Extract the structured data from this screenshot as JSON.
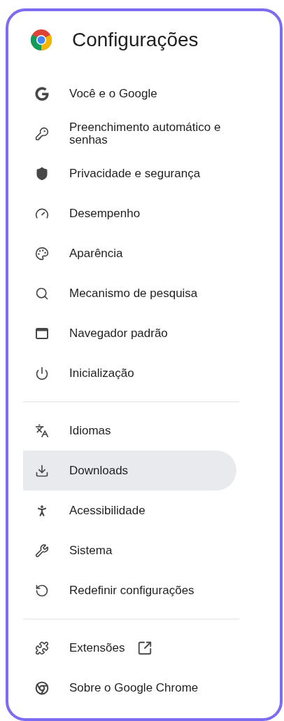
{
  "header": {
    "title": "Configurações"
  },
  "sections": [
    {
      "items": [
        {
          "label": "Você e o Google",
          "selected": false,
          "external_link": false
        },
        {
          "label": "Preenchimento automático e senhas",
          "selected": false,
          "external_link": false
        },
        {
          "label": "Privacidade e segurança",
          "selected": false,
          "external_link": false
        },
        {
          "label": "Desempenho",
          "selected": false,
          "external_link": false
        },
        {
          "label": "Aparência",
          "selected": false,
          "external_link": false
        },
        {
          "label": "Mecanismo de pesquisa",
          "selected": false,
          "external_link": false
        },
        {
          "label": "Navegador padrão",
          "selected": false,
          "external_link": false
        },
        {
          "label": "Inicialização",
          "selected": false,
          "external_link": false
        }
      ]
    },
    {
      "items": [
        {
          "label": "Idiomas",
          "selected": false,
          "external_link": false
        },
        {
          "label": "Downloads",
          "selected": true,
          "external_link": false
        },
        {
          "label": "Acessibilidade",
          "selected": false,
          "external_link": false
        },
        {
          "label": "Sistema",
          "selected": false,
          "external_link": false
        },
        {
          "label": "Redefinir configurações",
          "selected": false,
          "external_link": false
        }
      ]
    },
    {
      "items": [
        {
          "label": "Extensões",
          "selected": false,
          "external_link": true
        },
        {
          "label": "Sobre o Google Chrome",
          "selected": false,
          "external_link": false
        }
      ]
    }
  ]
}
